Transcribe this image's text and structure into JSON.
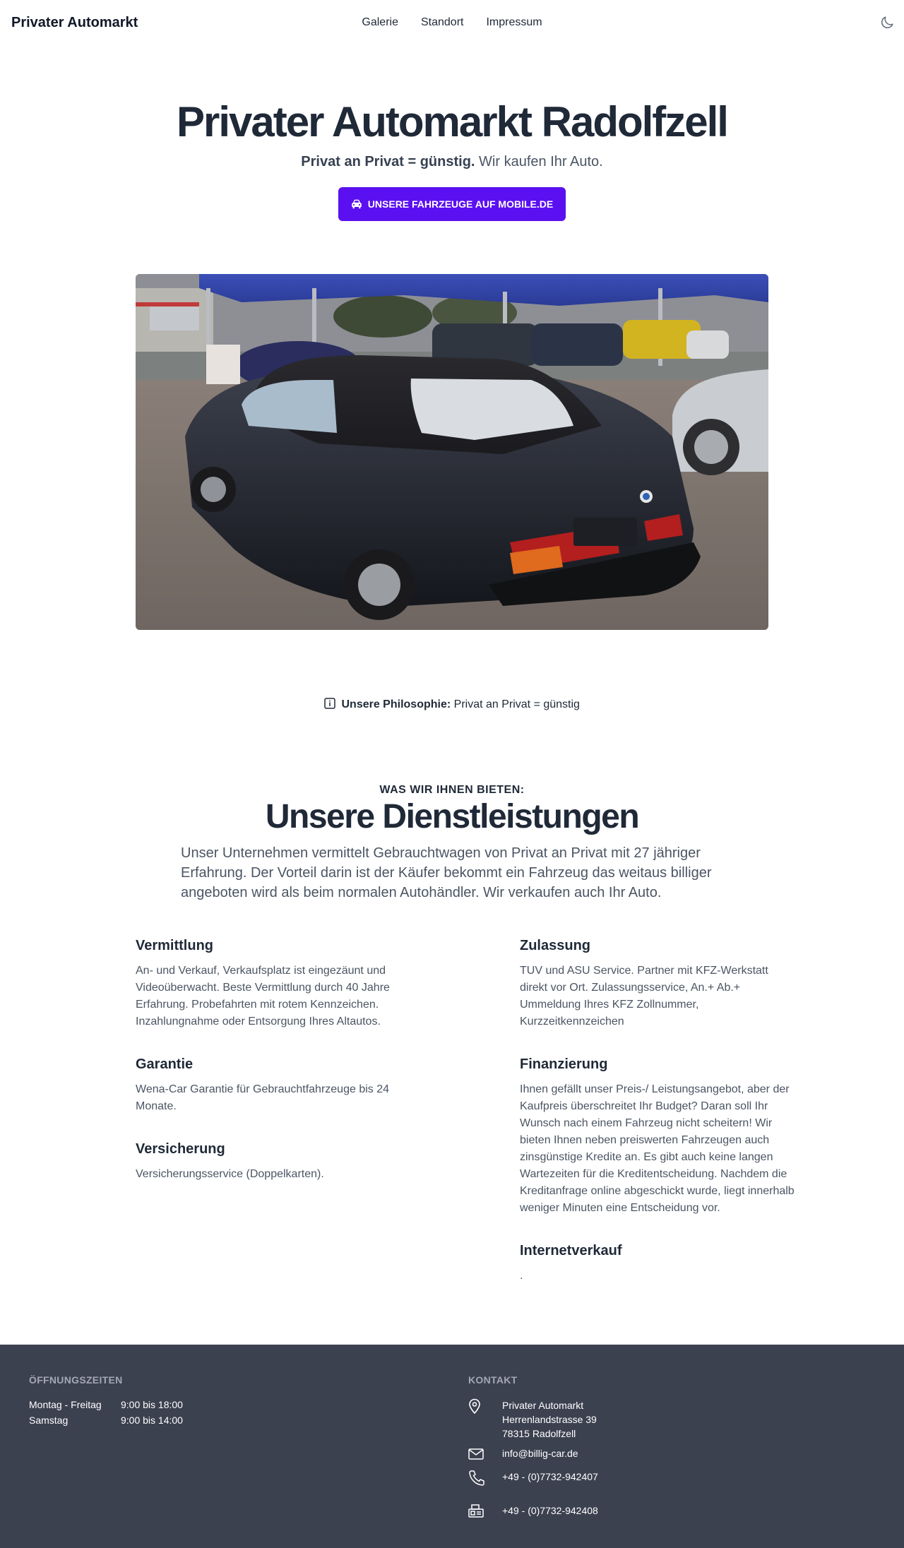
{
  "header": {
    "brand": "Privater Automarkt",
    "nav": [
      "Galerie",
      "Standort",
      "Impressum"
    ],
    "theme_icon": "moon-icon"
  },
  "hero": {
    "title": "Privater Automarkt Radolfzell",
    "tagline_bold": "Privat an Privat = günstig.",
    "tagline_rest": "Wir kaufen Ihr Auto.",
    "cta_label": "UNSERE FAHRZEUGE AUF MOBILE.DE",
    "cta_icon": "car-icon"
  },
  "image": {
    "alt": "Schwarzes BMW Cabrio"
  },
  "philosophy": {
    "icon": "info-icon",
    "label": "Unsere Philosophie:",
    "text": "Privat an Privat = günstig"
  },
  "services": {
    "eyebrow": "WAS WIR IHNEN BIETEN:",
    "title": "Unsere Dienstleistungen",
    "intro": "Unser Unternehmen vermittelt Gebrauchtwagen von Privat an Privat mit 27 jähriger Erfahrung. Der Vorteil darin ist der Käufer bekommt ein Fahrzeug das weitaus billiger angeboten wird als beim normalen Autohändler. Wir verkaufen auch Ihr Auto.",
    "items": [
      {
        "title": "Vermittlung",
        "text": "An- und Verkauf, Verkaufsplatz ist eingezäunt und Videoüberwacht. Beste Vermittlung durch 40 Jahre Erfahrung. Probefahrten mit rotem Kennzeichen. Inzahlungnahme oder Entsorgung Ihres Altautos."
      },
      {
        "title": "Zulassung",
        "text": "TUV und ASU Service. Partner mit KFZ-Werkstatt direkt vor Ort. Zulassungsservice, An.+ Ab.+ Ummeldung Ihres KFZ Zollnummer, Kurzzeitkennzeichen"
      },
      {
        "title": "Garantie",
        "text": "Wena-Car Garantie für Gebrauchtfahrzeuge bis 24 Monate."
      },
      {
        "title": "Finanzierung",
        "text": "Ihnen gefällt unser Preis-/ Leistungsangebot, aber der Kaufpreis überschreitet Ihr Budget? Daran soll Ihr Wunsch nach einem Fahrzeug nicht scheitern! Wir bieten Ihnen neben preiswerten Fahrzeugen auch zinsgünstige Kredite an. Es gibt auch keine langen Wartezeiten für die Kreditentscheidung. Nachdem die Kreditanfrage online abgeschickt wurde, liegt innerhalb weniger Minuten eine Entscheidung vor."
      },
      {
        "title": "Versicherung",
        "text": "Versicherungsservice (Doppelkarten)."
      },
      {
        "title": "Internetverkauf",
        "text": "."
      }
    ]
  },
  "footer": {
    "hours_heading": "ÖFFNUNGSZEITEN",
    "hours": [
      {
        "day": "Montag - Freitag",
        "time": "9:00 bis 18:00"
      },
      {
        "day": "Samstag",
        "time": "9:00 bis 14:00"
      }
    ],
    "contact_heading": "KONTAKT",
    "address_lines": [
      "Privater Automarkt",
      "Herrenlandstrasse 39",
      "78315 Radolfzell"
    ],
    "email": "info@billig-car.de",
    "phone": "+49 - (0)7732-942407",
    "fax": "+49 - (0)7732-942408"
  }
}
